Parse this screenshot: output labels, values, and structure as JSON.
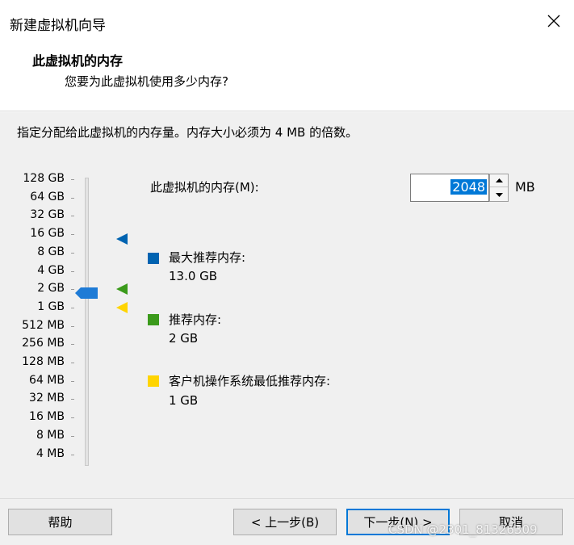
{
  "window": {
    "title": "新建虚拟机向导"
  },
  "header": {
    "title": "此虚拟机的内存",
    "subtitle": "您要为此虚拟机使用多少内存?"
  },
  "instruction": "指定分配给此虚拟机的内存量。内存大小必须为 4 MB 的倍数。",
  "scale": {
    "labels": [
      "128 GB",
      "64 GB",
      "32 GB",
      "16 GB",
      "8 GB",
      "4 GB",
      "2 GB",
      "1 GB",
      "512 MB",
      "256 MB",
      "128 MB",
      "64 MB",
      "32 MB",
      "16 MB",
      "8 MB",
      "4 MB"
    ],
    "selected_label": "2 GB"
  },
  "memory": {
    "label": "此虚拟机的内存(M):",
    "value": "2048",
    "unit": "MB"
  },
  "legend": [
    {
      "label": "最大推荐内存:",
      "value": "13.0 GB",
      "color": "#0063b1",
      "marker_at": "16 GB"
    },
    {
      "label": "推荐内存:",
      "value": "2 GB",
      "color": "#3b9a1b",
      "marker_at": "2 GB"
    },
    {
      "label": "客户机操作系统最低推荐内存:",
      "value": "1 GB",
      "color": "#ffd400",
      "marker_at": "1 GB"
    }
  ],
  "buttons": {
    "help": "帮助",
    "back": "< 上一步(B)",
    "next": "下一步(N) >",
    "cancel": "取消"
  },
  "watermark": "CSDN @2301_81326309",
  "colors": {
    "slider_thumb": "#1e7bd6",
    "accent": "#0078d7"
  }
}
